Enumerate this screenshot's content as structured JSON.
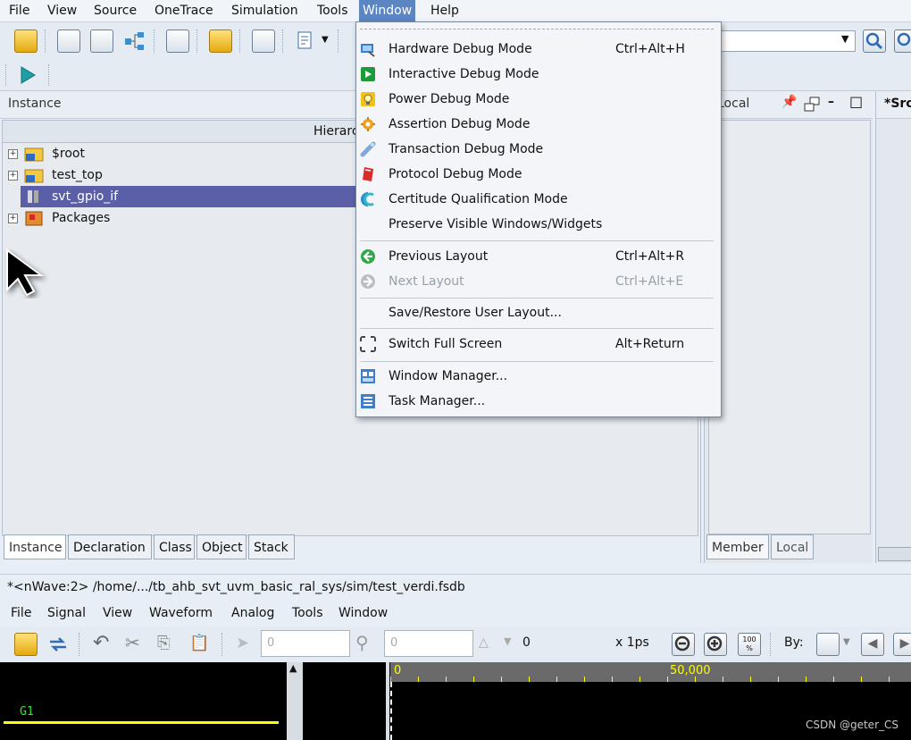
{
  "menubar": {
    "items": [
      "File",
      "View",
      "Source",
      "OneTrace",
      "Simulation",
      "Tools",
      "Window",
      "Help"
    ],
    "active": "Window"
  },
  "instance_panel": {
    "title": "Instance",
    "tree_header": "Hierarchy",
    "rows": [
      "$root",
      "test_top",
      "svt_gpio_if",
      "Packages"
    ],
    "selected": "svt_gpio_if",
    "tabs": [
      "Instance",
      "Declaration",
      "Class",
      "Object",
      "Stack"
    ]
  },
  "local_panel": {
    "title": "Local",
    "tabs": [
      "Member",
      "Local"
    ]
  },
  "source_panel": {
    "title": "*Src"
  },
  "window_menu": {
    "items": [
      {
        "label": "Hardware Debug Mode",
        "shortcut": "Ctrl+Alt+H",
        "icon": "hardware-debug-icon",
        "enabled": true
      },
      {
        "label": "Interactive Debug Mode",
        "shortcut": "",
        "icon": "interactive-debug-icon",
        "enabled": true
      },
      {
        "label": "Power Debug Mode",
        "shortcut": "",
        "icon": "power-debug-icon",
        "enabled": true
      },
      {
        "label": "Assertion Debug Mode",
        "shortcut": "",
        "icon": "assertion-debug-icon",
        "enabled": true
      },
      {
        "label": "Transaction Debug Mode",
        "shortcut": "",
        "icon": "transaction-debug-icon",
        "enabled": true
      },
      {
        "label": "Protocol Debug Mode",
        "shortcut": "",
        "icon": "protocol-debug-icon",
        "enabled": true
      },
      {
        "label": "Certitude Qualification Mode",
        "shortcut": "",
        "icon": "certitude-icon",
        "enabled": true
      },
      {
        "label": "Preserve Visible Windows/Widgets",
        "shortcut": "",
        "icon": "",
        "enabled": true
      },
      {
        "label": "Previous Layout",
        "shortcut": "Ctrl+Alt+R",
        "icon": "previous-layout-icon",
        "enabled": true
      },
      {
        "label": "Next Layout",
        "shortcut": "Ctrl+Alt+E",
        "icon": "next-layout-icon",
        "enabled": false
      },
      {
        "label": "Save/Restore User Layout...",
        "shortcut": "",
        "icon": "",
        "enabled": true
      },
      {
        "label": "Switch Full Screen",
        "shortcut": "Alt+Return",
        "icon": "fullscreen-icon",
        "enabled": true
      },
      {
        "label": "Window Manager...",
        "shortcut": "",
        "icon": "window-manager-icon",
        "enabled": true
      },
      {
        "label": "Task Manager...",
        "shortcut": "",
        "icon": "task-manager-icon",
        "enabled": true
      }
    ]
  },
  "nwave": {
    "title": "*<nWave:2> /home/.../tb_ahb_svt_uvm_basic_ral_sys/sim/test_verdi.fsdb",
    "menu": [
      "File",
      "Signal",
      "View",
      "Waveform",
      "Analog",
      "Tools",
      "Window"
    ],
    "cursor_value": "0",
    "marker_value": "0",
    "delta_value": "0",
    "time_unit": "x 1ps",
    "zoom_label": "100 %",
    "by_label": "By:",
    "ruler_start": "0",
    "ruler_mark": "50,000",
    "signal_group": "G1"
  },
  "watermark": "CSDN @geter_CS",
  "colors": {
    "menu_highlight": "#5b86c2",
    "selection": "#5b5fa8",
    "wave_bg": "#000000",
    "wave_signal": "#ffff00",
    "ruler_text": "#ffff00"
  }
}
